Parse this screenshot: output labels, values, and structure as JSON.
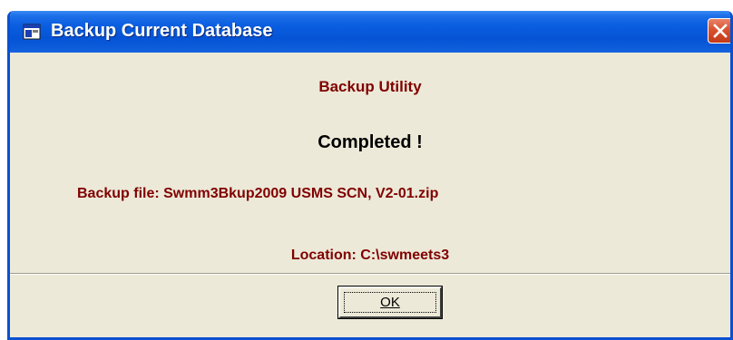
{
  "window": {
    "title": "Backup Current Database"
  },
  "content": {
    "utility_title": "Backup Utility",
    "status": "Completed !",
    "backup_file": "Backup file: Swmm3Bkup2009 USMS SCN, V2-01.zip",
    "location": "Location: C:\\swmeets3"
  },
  "buttons": {
    "ok_label": "OK"
  },
  "icons": {
    "title_icon": "app-window-icon",
    "close": "close-icon"
  },
  "colors": {
    "titlebar": "#0a5ee0",
    "body": "#ece9d8",
    "accent_text": "#800000",
    "close_button": "#d9512f"
  }
}
